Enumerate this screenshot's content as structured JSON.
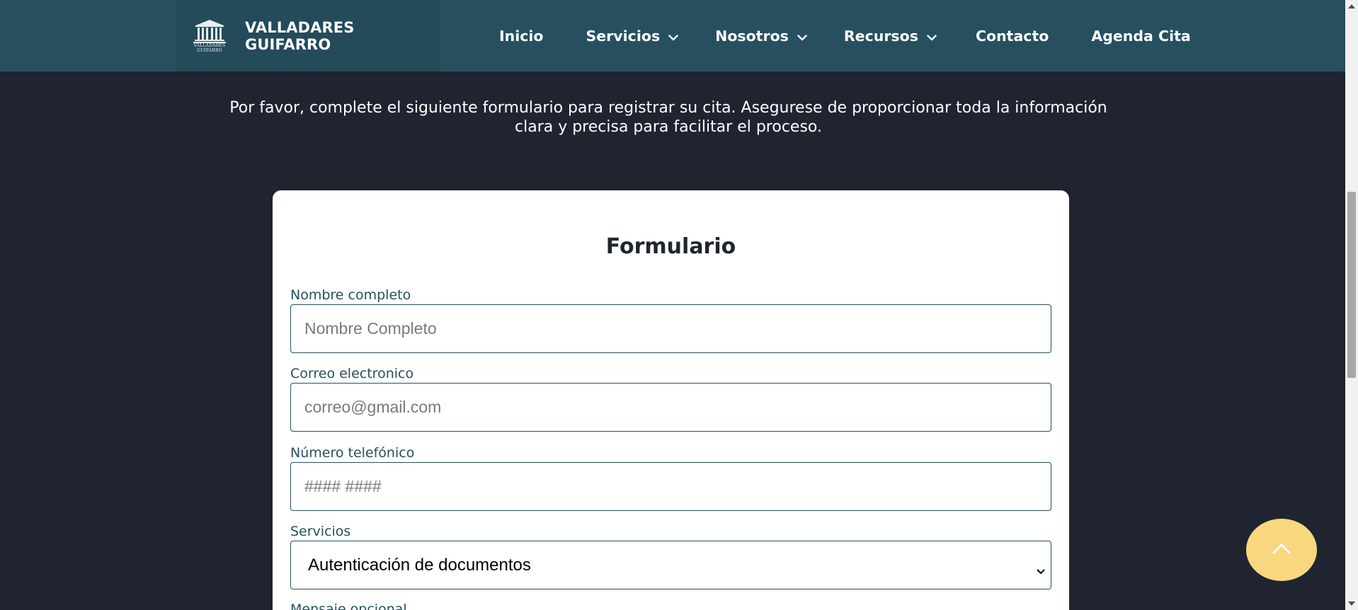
{
  "header": {
    "brand": {
      "name": "VALLADARES GUIFARRO",
      "logo_text_line1": "VALLADARES",
      "logo_text_line2": "GUIFARRO",
      "logo_icon": "courthouse-columns-icon"
    },
    "nav": [
      {
        "label": "Inicio",
        "has_dropdown": false
      },
      {
        "label": "Servicios",
        "has_dropdown": true
      },
      {
        "label": "Nosotros",
        "has_dropdown": true
      },
      {
        "label": "Recursos",
        "has_dropdown": true
      },
      {
        "label": "Contacto",
        "has_dropdown": false
      },
      {
        "label": "Agenda Cita",
        "has_dropdown": false
      }
    ]
  },
  "intro": {
    "text": "Por favor, complete el siguiente formulario para registrar su cita. Asegurese de proporcionar toda la información clara y precisa para facilitar el proceso."
  },
  "form": {
    "title": "Formulario",
    "fields": {
      "name": {
        "label": "Nombre completo",
        "placeholder": "Nombre Completo",
        "value": ""
      },
      "email": {
        "label": "Correo electronico",
        "placeholder": "correo@gmail.com",
        "value": ""
      },
      "phone": {
        "label": "Número telefónico",
        "placeholder": "#### ####",
        "value": ""
      },
      "service": {
        "label": "Servicios",
        "selected": "Autenticación de documentos"
      },
      "message": {
        "label": "Mensaje opcional"
      }
    }
  },
  "colors": {
    "page_background": "#1f2430",
    "header_background": "#26505f",
    "card_background": "#ffffff",
    "accent": "#26505f",
    "back_to_top": "#f8d77e"
  },
  "back_to_top_icon": "chevron-up-icon"
}
